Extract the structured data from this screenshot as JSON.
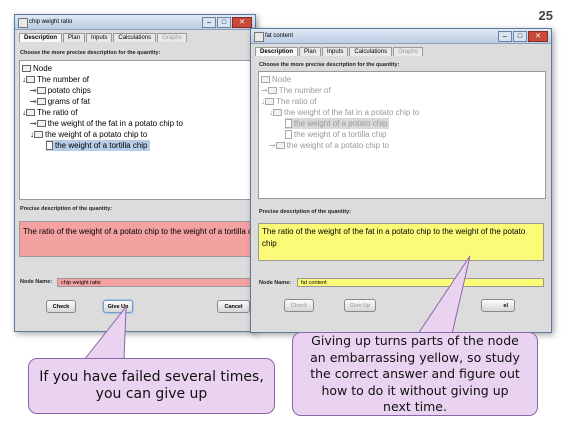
{
  "page_number": "25",
  "left_window": {
    "title": "chip weight ratio",
    "tabs": [
      "Description",
      "Plan",
      "Inputs",
      "Calculations",
      "Graphs"
    ],
    "tree_heading": "Choose the more precise description for the quantity:",
    "tree": [
      {
        "label": "Node"
      },
      {
        "label": "The number of"
      },
      {
        "label": "potato chips"
      },
      {
        "label": "grams of fat"
      },
      {
        "label": "The ratio of"
      },
      {
        "label": "the weight of the fat in a potato chip to"
      },
      {
        "label": "the weight of a potato chip to"
      },
      {
        "label": "the weight of a tortilla chip",
        "selected": true
      }
    ],
    "precise_heading": "Precise description of the quantity:",
    "precise_text": "The ratio of the weight of a potato chip to the weight of a tortilla chip",
    "node_name_label": "Node Name:",
    "node_name_value": "chip weight ratio",
    "buttons": {
      "check": "Check",
      "giveup": "Give Up",
      "cancel": "Cancel"
    },
    "colors": {
      "highlight": "#f4a1a1"
    }
  },
  "right_window": {
    "title": "fat content",
    "tabs": [
      "Description",
      "Plan",
      "Inputs",
      "Calculations",
      "Graphs"
    ],
    "tree_heading": "Choose the more precise description for the quantity:",
    "tree": [
      {
        "label": "Node"
      },
      {
        "label": "The number of"
      },
      {
        "label": "The ratio of"
      },
      {
        "label": "the weight of the fat in a potato chip to"
      },
      {
        "label": "the weight of a potato chip",
        "selected": true
      },
      {
        "label": "the weight of a tortilla chip"
      },
      {
        "label": "the weight of a potato chip to"
      }
    ],
    "precise_heading": "Precise description of the quantity:",
    "precise_text_line1": "The ratio of the weight of the fat in a potato chip to the weight of the potato",
    "precise_text_line2": "chip",
    "node_name_label": "Node Name:",
    "node_name_value": "fat content",
    "buttons": {
      "check": "Check",
      "giveup": "Give Up",
      "cancel": "el"
    },
    "colors": {
      "highlight": "#fbfb78"
    }
  },
  "callout_left": {
    "line1": "If you have failed several times,",
    "line2": "you can give up"
  },
  "callout_right": {
    "line1": "Giving up turns parts of the node",
    "line2": "an embarrassing yellow, so study",
    "line3": "the correct answer and figure out",
    "line4": "how to do it without giving up",
    "line5": "next time."
  },
  "colors": {
    "callout_fill": "#e9d3f1",
    "callout_border": "#8a67a8"
  }
}
